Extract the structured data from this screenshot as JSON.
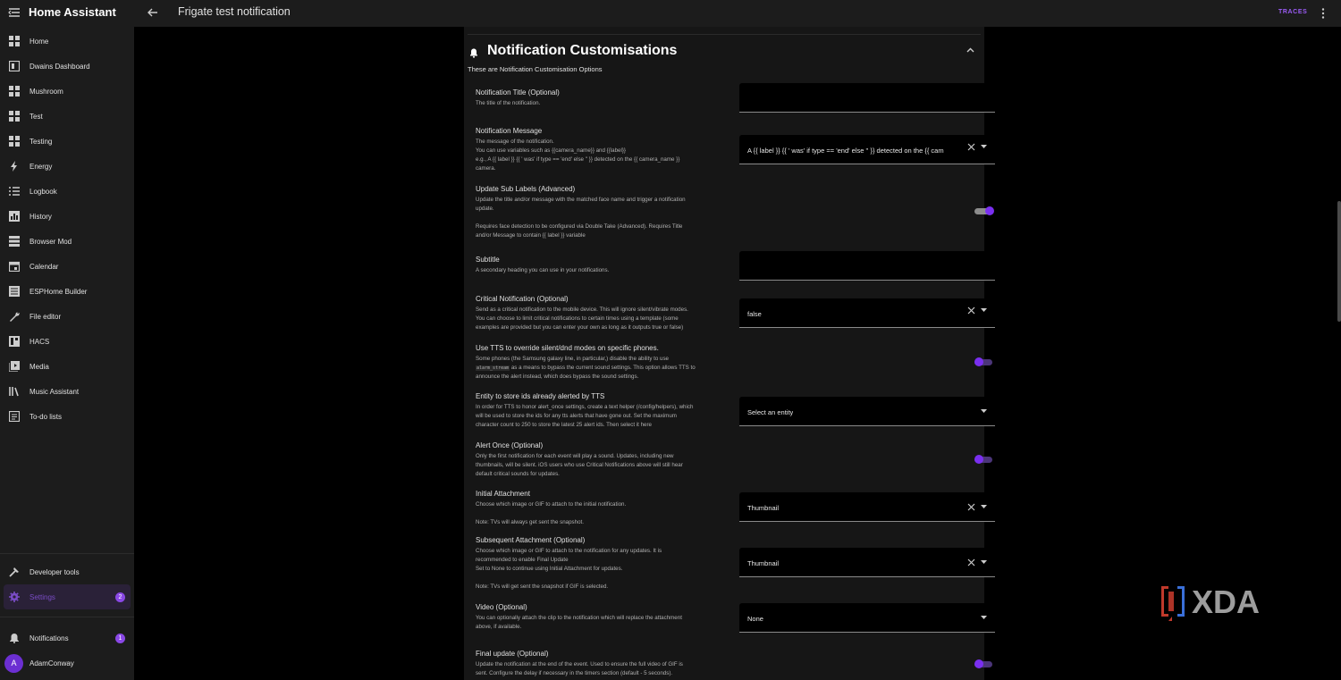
{
  "app": {
    "title": "Home Assistant"
  },
  "header": {
    "page_title": "Frigate test notification",
    "traces_label": "TRACES"
  },
  "sidebar": {
    "items": [
      {
        "label": "Home",
        "icon": "grid-icon"
      },
      {
        "label": "Dwains Dashboard",
        "icon": "dashboard-icon"
      },
      {
        "label": "Mushroom",
        "icon": "grid-icon"
      },
      {
        "label": "Test",
        "icon": "grid-icon"
      },
      {
        "label": "Testing",
        "icon": "grid-icon"
      },
      {
        "label": "Energy",
        "icon": "lightning-icon"
      },
      {
        "label": "Logbook",
        "icon": "list-icon"
      },
      {
        "label": "History",
        "icon": "chart-icon"
      },
      {
        "label": "Browser Mod",
        "icon": "server-icon"
      },
      {
        "label": "Calendar",
        "icon": "calendar-icon"
      },
      {
        "label": "ESPHome Builder",
        "icon": "chip-icon"
      },
      {
        "label": "File editor",
        "icon": "wrench-icon"
      },
      {
        "label": "HACS",
        "icon": "hacs-icon"
      },
      {
        "label": "Media",
        "icon": "media-icon"
      },
      {
        "label": "Music Assistant",
        "icon": "library-icon"
      },
      {
        "label": "To-do lists",
        "icon": "checklist-icon"
      }
    ],
    "developer_tools": "Developer tools",
    "settings": {
      "label": "Settings",
      "badge": "2"
    },
    "notifications": {
      "label": "Notifications",
      "badge": "1"
    },
    "user": {
      "name": "AdamConway",
      "initial": "A"
    }
  },
  "section": {
    "title": "Notification Customisations",
    "description": "These are Notification Customisation Options"
  },
  "settings": {
    "notification_title": {
      "title": "Notification Title (Optional)",
      "desc": "The title of the notification.",
      "value": ""
    },
    "notification_message": {
      "title": "Notification Message",
      "desc": "The message of the notification.\nYou can use variables such as {{camera_name}} and {{label}}\ne.g., A {{ label }} {{ ' was' if type == 'end' else '' }} detected on the {{ camera_name }}\ncamera.",
      "value": "A {{ label }} {{ ' was' if type == 'end' else '' }} detected on the {{ cam"
    },
    "update_sub_labels": {
      "title": "Update Sub Labels (Advanced)",
      "desc": "Update the title and/or message with the matched face name and trigger a notification\nupdate.\n\nRequires face detection to be configured via Double Take (Advanced). Requires Title\nand/or Message to contain {{ label }} variable"
    },
    "subtitle": {
      "title": "Subtitle",
      "desc": "A secondary heading you can use in your notifications.",
      "value": ""
    },
    "critical": {
      "title": "Critical Notification (Optional)",
      "desc": "Send as a critical notification to the mobile device. This will ignore silent/vibrate modes.\nYou can choose to limit critical notifications to certain times using a template (some\nexamples are provided but you can enter your own as long as it outputs true or false)",
      "value": "false"
    },
    "tts_override": {
      "title": "Use TTS to override silent/dnd modes on specific phones.",
      "desc_before": "Some phones (the Samsung galaxy line, in particular,) disable the ability to use\n",
      "code": "alarm_stream",
      "desc_after": " as a means to bypass the current sound settings. This option allows TTS to\nannounce the alert instead, which does bypass the sound settings."
    },
    "entity_store": {
      "title": "Entity to store ids already alerted by TTS",
      "desc": "In order for TTS to honor alert_once settings, create a text helper (/config/helpers), which\nwill be used to store the ids for any tts alerts that have gone out. Set the maximum\ncharacter count to 250 to store the latest 25 alert ids. Then select it here",
      "value": "Select an entity"
    },
    "alert_once": {
      "title": "Alert Once (Optional)",
      "desc": "Only the first notification for each event will play a sound. Updates, including new\nthumbnails, will be silent. iOS users who use Critical Notifications above will still hear\ndefault critical sounds for updates."
    },
    "initial_attachment": {
      "title": "Initial Attachment",
      "desc": "Choose which image or GIF to attach to the initial notification.\n\nNote: TVs will always get sent the snapshot.",
      "value": "Thumbnail"
    },
    "subsequent_attachment": {
      "title": "Subsequent Attachment (Optional)",
      "desc": "Choose which image or GIF to attach to the notification for any updates. It is\nrecommended to enable Final Update\nSet to None to continue using Initial Attachment for updates.\n\nNote: TVs will get sent the snapshot if GIF is selected.",
      "value": "Thumbnail"
    },
    "video": {
      "title": "Video (Optional)",
      "desc": "You can optionally attach the clip to the notification which will replace the attachment\nabove, if available.",
      "value": "None"
    },
    "final_update": {
      "title": "Final update (Optional)",
      "desc": "Update the notification at the end of the event. Used to ensure the full video of GIF is\nsent. Configure the delay if necessary in the timers section (default - 5 seconds)."
    }
  },
  "colors": {
    "accent": "#7a2ff0",
    "traces": "#9b5cf6",
    "badge": "#8a48e6"
  },
  "watermark": "XDA"
}
